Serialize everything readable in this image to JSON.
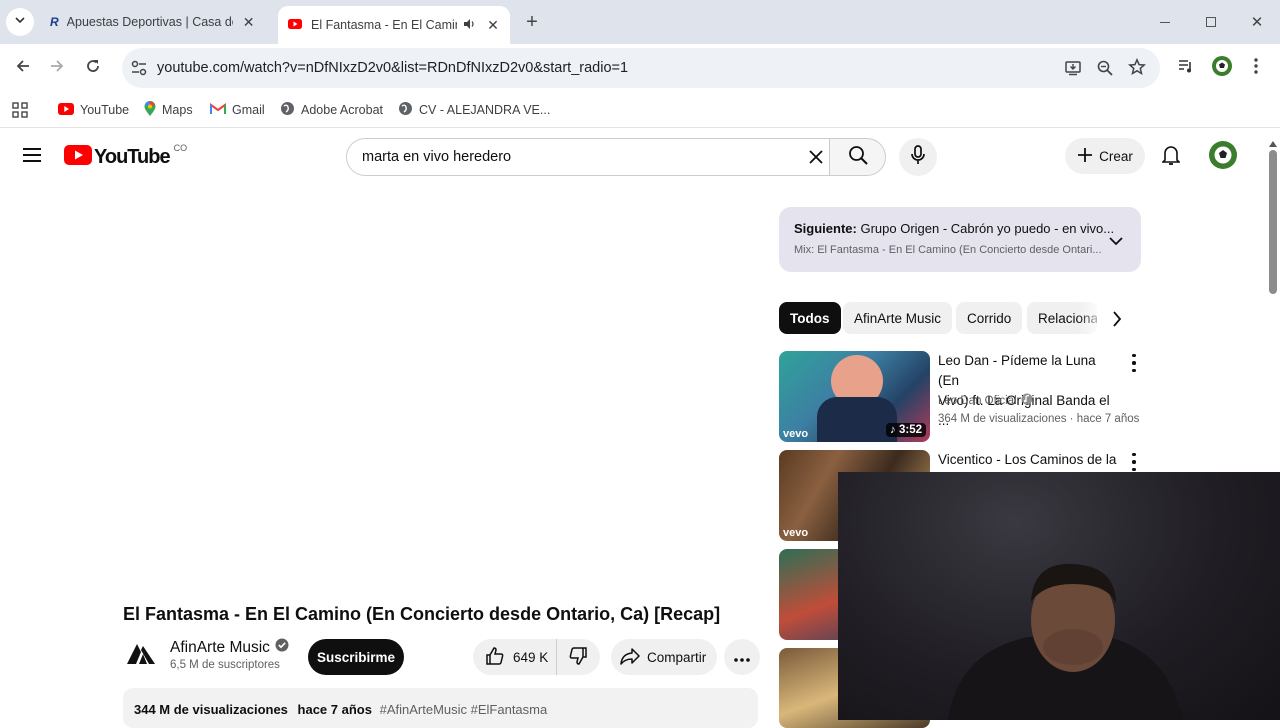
{
  "browser": {
    "tabs": [
      {
        "title": "Apuestas Deportivas | Casa de A",
        "icon": "rush-logo-icon",
        "active": false
      },
      {
        "title": "El Fantasma - En El Camino",
        "icon": "youtube-icon",
        "active": true
      }
    ],
    "url": "youtube.com/watch?v=nDfNIxzD2v0&list=RDnDfNIxzD2v0&start_radio=1",
    "bookmarks": [
      "YouTube",
      "Maps",
      "Gmail",
      "Adobe Acrobat",
      "CV - ALEJANDRA VE..."
    ]
  },
  "youtube": {
    "country_code": "CO",
    "search_query": "marta en vivo heredero",
    "create_label": "Crear",
    "queue": {
      "next_label": "Siguiente:",
      "next_title": "Grupo Origen - Cabrón yo puedo - en vivo...",
      "mix_label": "Mix: El Fantasma - En El Camino (En Concierto desde Ontari..."
    },
    "chips": [
      "Todos",
      "AfinArte Music",
      "Corrido",
      "Relacionad"
    ],
    "recommendations": [
      {
        "title_line1": "Leo Dan - Pídeme la Luna (En",
        "title_line2": "Vivo) ft. La Original Banda el ...",
        "channel": "Leo Dan Oficial",
        "meta": "364 M de visualizaciones · hace 7 años",
        "duration": "3:52",
        "badge": "vevo"
      },
      {
        "title_line1": "Vicentico - Los Caminos de la",
        "badge": "vevo"
      }
    ],
    "video": {
      "title": "El Fantasma - En El Camino (En Concierto desde Ontario, Ca) [Recap]",
      "channel": "AfinArte Music",
      "subscribers": "6,5 M de suscriptores",
      "subscribe_label": "Suscribirme",
      "likes": "649 K",
      "share_label": "Compartir",
      "views": "344 M de visualizaciones",
      "age": "hace 7 años",
      "hashtags": "#AfinArteMusic #ElFantasma"
    }
  },
  "colors": {
    "youtube_red": "#ff0000",
    "tabstrip": "#dfe3eb",
    "queue_bg": "#e5e3ee"
  }
}
